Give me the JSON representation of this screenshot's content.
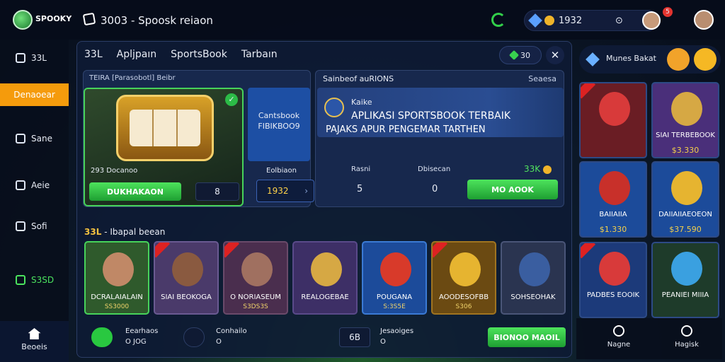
{
  "topbar": {
    "logo_text": "SPOOKY",
    "title": "3003 - Spoosk reiaon",
    "balance": "1932",
    "notification_count": "5"
  },
  "sidebar": {
    "items": [
      {
        "label": "33L",
        "icon": "square-icon"
      },
      {
        "label": "Denaoear",
        "icon": "none",
        "active": true
      },
      {
        "label": "Sane",
        "icon": "edit-icon"
      },
      {
        "label": "Aeie",
        "icon": "tools-icon"
      },
      {
        "label": "Sofi",
        "icon": "settings-icon"
      },
      {
        "label": "S3SD",
        "icon": "chat-icon"
      }
    ],
    "home_label": "Beoeis"
  },
  "main": {
    "tabs": [
      "33L",
      "Apljpaın",
      "SportsBook",
      "Tarbaın"
    ],
    "score_pill": "30",
    "left_panel": {
      "header": "TEIRA [Parasobotl] Beibr",
      "slot_sub": "293 Docanoo",
      "primary_button": "DUKHAKAON",
      "number_box": "8",
      "blue_card_line1": "Cantsbook",
      "blue_card_line2": "FIBIKBOO9",
      "edit_label": "Eolbiaon",
      "blue_input": "1932"
    },
    "right_panel": {
      "header": "Sainbeof auRIONS",
      "header_right": "Seaesa",
      "kicker": "Kaike",
      "headline": "APLIKASI SPORTSBOOK TERBAIK",
      "subline": "PAJAKS APUR PENGEMAR TARTHEN",
      "stats": [
        {
          "label": "Rasni",
          "value": "5"
        },
        {
          "label": "Dbisecan",
          "value": "0"
        }
      ],
      "coin_value": "33K",
      "button": "MO AOOK"
    },
    "section_label_prefix": "33L",
    "section_label": "- Ibapal beean",
    "games": [
      {
        "title": "DCRALAIALAIN",
        "sub": "SS3000",
        "bg": "#2f5a2c",
        "border": "#47d35a",
        "art": "#c08866",
        "hot": false
      },
      {
        "title": "SIAI BEOKOGA",
        "sub": "",
        "bg": "#4a3a6a",
        "border": "#6a5a92",
        "art": "#8a5a40",
        "hot": true
      },
      {
        "title": "O NORIASEUM",
        "sub": "S3DS3S",
        "bg": "#4a2e4e",
        "border": "#6a4a6a",
        "art": "#a07060",
        "hot": true
      },
      {
        "title": "REALOGEBAE",
        "sub": "",
        "bg": "#3d2f66",
        "border": "#5a4a8a",
        "art": "#d6a844",
        "hot": false
      },
      {
        "title": "POUGANA",
        "sub": "S:3S5E",
        "bg": "#1c4b9a",
        "border": "#3b7ad4",
        "art": "#d83a2a",
        "hot": false
      },
      {
        "title": "AOODESOFBB",
        "sub": "S306",
        "bg": "#6b4a12",
        "border": "#a07420",
        "art": "#e6b430",
        "hot": true
      },
      {
        "title": "SOHSEOHAK",
        "sub": "",
        "bg": "#2a3450",
        "border": "#4a5578",
        "art": "#3a5ea0",
        "hot": false
      }
    ],
    "footer": {
      "item1_title": "Eearhaos",
      "item1_value": "O JOG",
      "item2_title": "Conhailo",
      "item2_value": "O",
      "item3_box": "6B",
      "item3_title": "Jesaoiges",
      "item3_value": "O",
      "button": "BIONOO MAOIL"
    }
  },
  "right": {
    "header_label": "Munes Bakat",
    "cards": [
      {
        "title": "",
        "value": "",
        "bg": "#6a1d24",
        "art": "#d83a3a",
        "hot": true
      },
      {
        "title": "SIAI TERBEBOOK",
        "value": "$3.330",
        "bg": "#4a2f7a",
        "art": "#d6a844",
        "hot": false
      },
      {
        "title": "BAIIAIIA",
        "value": "$1.330",
        "bg": "#1c4b9a",
        "art": "#c8302a",
        "hot": false
      },
      {
        "title": "DAIIAIIAEOEON",
        "value": "$37.590",
        "bg": "#1c4b9a",
        "art": "#e6b430",
        "hot": false
      },
      {
        "title": "PADBES EOOIK",
        "value": "",
        "bg": "#1c3a7a",
        "art": "#d83a3a",
        "hot": true
      },
      {
        "title": "PEANIEI MIIIA",
        "value": "",
        "bg": "#1e3b2a",
        "art": "#3aa0e0",
        "hot": false
      }
    ],
    "footer": [
      {
        "label": "Nagne",
        "icon": "search-icon"
      },
      {
        "label": "Hagisk",
        "icon": "gear-icon"
      }
    ]
  }
}
